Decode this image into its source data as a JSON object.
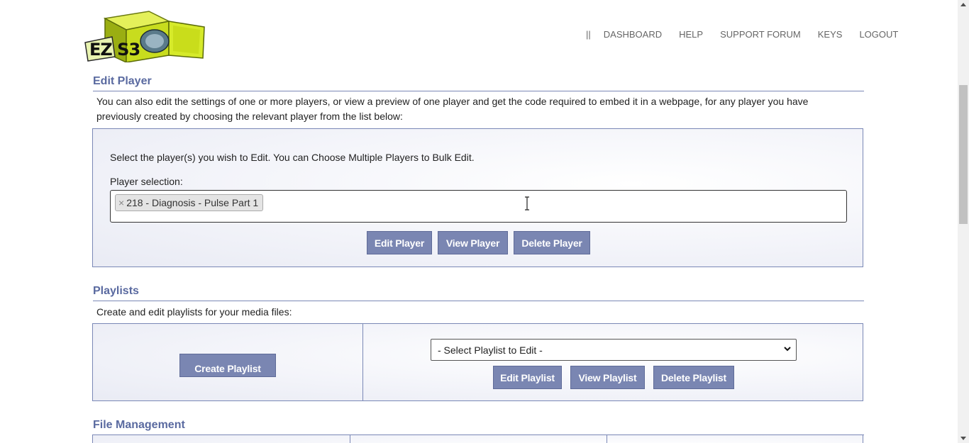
{
  "header": {
    "logo_text": "EZ S3",
    "nav": {
      "separator": "||",
      "items": [
        "DASHBOARD",
        "HELP",
        "SUPPORT FORUM",
        "KEYS",
        "LOGOUT"
      ]
    }
  },
  "edit_player": {
    "title": "Edit Player",
    "description": "You can also edit the settings of one or more players, or view a preview of one player and get the code required to embed it in a webpage, for any player you have previously created by choosing the relevant player from the list below:",
    "instruction": "Select the player(s) you wish to Edit. You can Choose Multiple Players to Bulk Edit.",
    "selection_label": "Player selection:",
    "selected_tag": "218 - Diagnosis - Pulse Part 1",
    "tag_remove": "×",
    "buttons": {
      "edit": "Edit Player",
      "view": "View Player",
      "delete": "Delete Player"
    }
  },
  "playlists": {
    "title": "Playlists",
    "description": "Create and edit playlists for your media files:",
    "create_button": "Create Playlist",
    "select_value": "- Select Playlist to Edit -",
    "buttons": {
      "edit": "Edit Playlist",
      "view": "View Playlist",
      "delete": "Delete Playlist"
    }
  },
  "file_management": {
    "title": "File Management"
  },
  "colors": {
    "accent": "#5a6aa0",
    "button": "#7a86b2",
    "border": "#7a88b6",
    "logo_green": "#c8dc1e"
  }
}
